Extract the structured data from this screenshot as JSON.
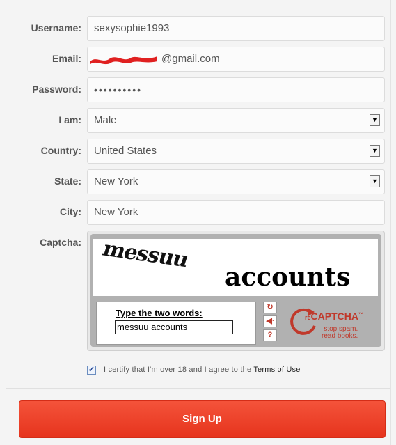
{
  "form": {
    "username": {
      "label": "Username:",
      "value": "sexysophie1993"
    },
    "email": {
      "label": "Email:",
      "value_suffix": "@gmail.com"
    },
    "password": {
      "label": "Password:",
      "value": "••••••••••"
    },
    "gender": {
      "label": "I am:",
      "value": "Male"
    },
    "country": {
      "label": "Country:",
      "value": "United States"
    },
    "state": {
      "label": "State:",
      "value": "New York"
    },
    "city": {
      "label": "City:",
      "value": "New York"
    },
    "captcha": {
      "label": "Captcha:",
      "word1": "messuu",
      "word2": "accounts",
      "prompt": "Type the two words:",
      "response": "messuu accounts",
      "brand": "reCAPTCHA",
      "brand_prefix": "re",
      "brand_main": "CAPTCHA",
      "tm": "™",
      "tagline_line1": "stop spam.",
      "tagline_line2": "read books."
    },
    "certify": {
      "checked": true,
      "text": "I certify that I'm over 18 and I agree to the ",
      "link": "Terms of Use"
    },
    "signup_label": "Sign Up"
  },
  "icons": {
    "refresh": "refresh-icon",
    "audio": "audio-icon",
    "help": "help-icon",
    "dropdown": "chevron-down-icon"
  },
  "colors": {
    "accent": "#e8402a",
    "redaction": "#e02020"
  }
}
